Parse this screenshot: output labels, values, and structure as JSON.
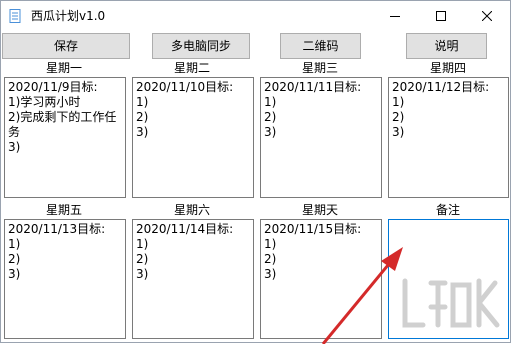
{
  "window": {
    "title": "西瓜计划v1.0",
    "controls": [
      "minimize",
      "maximize",
      "close"
    ]
  },
  "toolbar": {
    "save_label": "保存",
    "sync_label": "多电脑同步",
    "qrcode_label": "二维码",
    "help_label": "说明"
  },
  "days": [
    {
      "label": "星期一",
      "lines": [
        "2020/11/9目标:",
        "1)学习两小时",
        "2)完成剩下的工作任务",
        "3)"
      ]
    },
    {
      "label": "星期二",
      "lines": [
        "2020/11/10目标:",
        "1)",
        "2)",
        "3)"
      ]
    },
    {
      "label": "星期三",
      "lines": [
        "2020/11/11目标:",
        "1)",
        "2)",
        "3)"
      ]
    },
    {
      "label": "星期四",
      "lines": [
        "2020/11/12目标:",
        "1)",
        "2)",
        "3)"
      ]
    },
    {
      "label": "星期五",
      "lines": [
        "2020/11/13目标:",
        "1)",
        "2)",
        "3)"
      ]
    },
    {
      "label": "星期六",
      "lines": [
        "2020/11/14目标:",
        "1)",
        "2)",
        "3)"
      ]
    },
    {
      "label": "星期天",
      "lines": [
        "2020/11/15目标:",
        "1)",
        "2)",
        "3)"
      ]
    },
    {
      "label": "备注",
      "lines": []
    }
  ],
  "colors": {
    "button_bg": "#e1e1e1",
    "button_border": "#adadad",
    "textbox_border": "#7a7a7a",
    "focus_border": "#0078d7",
    "annotation_arrow": "#d42a2a",
    "app_icon": "#4a90d9"
  },
  "icons": {
    "app": "watermelon-app-icon",
    "minimize": "minimize-icon",
    "maximize": "maximize-icon",
    "close": "close-icon"
  }
}
